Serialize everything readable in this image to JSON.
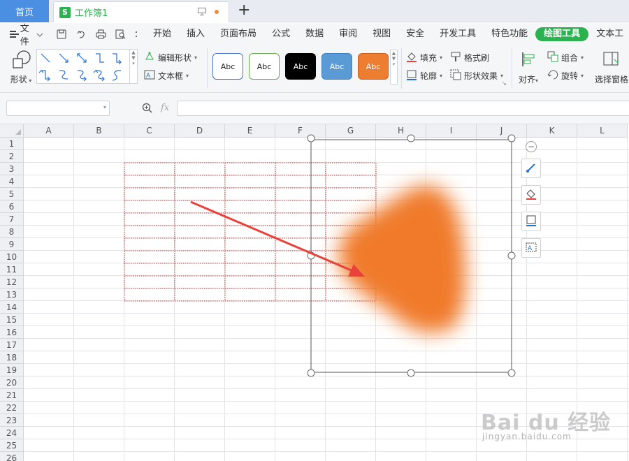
{
  "tabs": {
    "home_label": "首页",
    "doc_icon_letter": "S",
    "doc_title": "工作簿1",
    "accent_green": "#2bb14e",
    "home_blue": "#4a8fe2",
    "unsaved_dot_color": "#f08b3c"
  },
  "menu": {
    "file_label": "文件",
    "items": [
      "开始",
      "插入",
      "页面布局",
      "公式",
      "数据",
      "审阅",
      "视图",
      "安全",
      "开发工具",
      "特色功能",
      "绘图工具",
      "文本工"
    ],
    "active_item": "绘图工具"
  },
  "ribbon": {
    "shape_label": "形状",
    "edit_shape_label": "编辑形状",
    "textbox_label": "文本框",
    "style_presets": [
      {
        "label": "Abc",
        "fill": "#ffffff",
        "border": "#4a72c4",
        "text": "#222222"
      },
      {
        "label": "Abc",
        "fill": "#ffffff",
        "border": "#6aa84f",
        "text": "#222222"
      },
      {
        "label": "Abc",
        "fill": "#000000",
        "border": "#000000",
        "text": "#ffffff"
      },
      {
        "label": "Abc",
        "fill": "#5b9bd5",
        "border": "#3f7fbf",
        "text": "#ffffff"
      },
      {
        "label": "Abc",
        "fill": "#ed7d31",
        "border": "#c8621a",
        "text": "#ffffff"
      }
    ],
    "fill_label": "填充",
    "format_painter_label": "格式刷",
    "outline_label": "轮廓",
    "shape_effects_label": "形状效果",
    "align_label": "对齐",
    "group_label": "组合",
    "rotate_label": "旋转",
    "selection_pane_label": "选择窗格"
  },
  "formula_bar": {
    "name_box_value": "",
    "fx_label": "fx",
    "formula_value": ""
  },
  "sheet": {
    "columns": [
      "A",
      "B",
      "C",
      "D",
      "E",
      "F",
      "G",
      "H",
      "I",
      "J",
      "K",
      "L"
    ],
    "rows": [
      "1",
      "2",
      "3",
      "4",
      "5",
      "6",
      "7",
      "8",
      "9",
      "10",
      "11",
      "12",
      "13",
      "14",
      "15",
      "16",
      "17",
      "18",
      "19",
      "20",
      "21",
      "22",
      "23",
      "24",
      "25",
      "26"
    ],
    "dotted_range_color": "#c0392b",
    "blob_color": "#f07a2a",
    "arrow_color": "#e8423a"
  },
  "watermark": {
    "logo_text": "Bai du 经验",
    "url_text": "jingyan.baidu.com"
  }
}
